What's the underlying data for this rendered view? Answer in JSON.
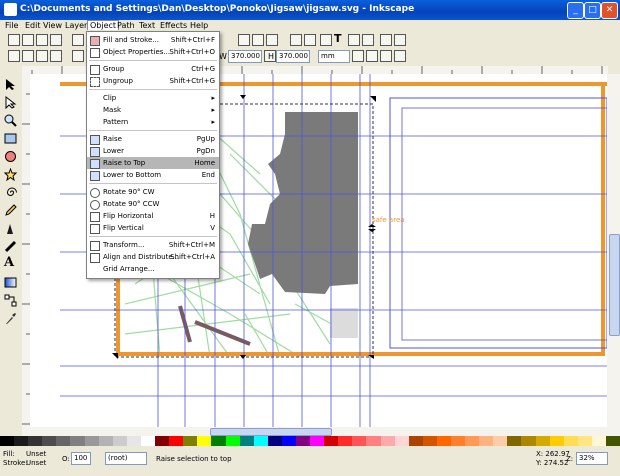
{
  "window": {
    "title": "C:\\Documents and Settings\\Dan\\Desktop\\Ponoko\\Jigsaw\\jigsaw.svg - Inkscape"
  },
  "menubar": [
    "File",
    "Edit",
    "View",
    "Layer",
    "Object",
    "Path",
    "Text",
    "Effects",
    "Help"
  ],
  "toolbar": {
    "w_label": "W",
    "w_value": "370.000",
    "h_label": "H",
    "h_value": "370.000",
    "unit": "mm"
  },
  "object_menu": {
    "items": [
      {
        "label": "Fill and Stroke...",
        "shortcut": "Shift+Ctrl+F"
      },
      {
        "label": "Object Properties...",
        "shortcut": "Shift+Ctrl+O"
      },
      {
        "label": "Group",
        "shortcut": "Ctrl+G"
      },
      {
        "label": "Ungroup",
        "shortcut": "Shift+Ctrl+G"
      },
      {
        "label": "Clip",
        "shortcut": "▸"
      },
      {
        "label": "Mask",
        "shortcut": "▸"
      },
      {
        "label": "Pattern",
        "shortcut": "▸"
      },
      {
        "label": "Raise",
        "shortcut": "PgUp"
      },
      {
        "label": "Lower",
        "shortcut": "PgDn"
      },
      {
        "label": "Raise to Top",
        "shortcut": "Home"
      },
      {
        "label": "Lower to Bottom",
        "shortcut": "End"
      },
      {
        "label": "Rotate 90° CW",
        "shortcut": ""
      },
      {
        "label": "Rotate 90° CCW",
        "shortcut": ""
      },
      {
        "label": "Flip Horizontal",
        "shortcut": "H"
      },
      {
        "label": "Flip Vertical",
        "shortcut": "V"
      },
      {
        "label": "Transform...",
        "shortcut": "Shift+Ctrl+M"
      },
      {
        "label": "Align and Distribute...",
        "shortcut": "Shift+Ctrl+A"
      },
      {
        "label": "Grid Arrange...",
        "shortcut": ""
      }
    ],
    "highlighted": "Raise to Top"
  },
  "canvas": {
    "annotation": "safe area"
  },
  "status": {
    "fill_label": "Fill:",
    "fill_value": "Unset",
    "stroke_label": "Stroke:",
    "stroke_value": "Unset",
    "opacity_label": "O:",
    "opacity_value": "100",
    "layer": "(root)",
    "message": "Raise selection to top",
    "x": "X: 262.97",
    "y": "Y: 274.52",
    "z_label": "Z:",
    "zoom": "32%"
  },
  "colors": {
    "accent": "#f0962e",
    "guide": "#4c56e0",
    "map_green": "#9fdc9f",
    "map_gray": "#7a7a7a",
    "highlight": "#b6b6b6"
  }
}
